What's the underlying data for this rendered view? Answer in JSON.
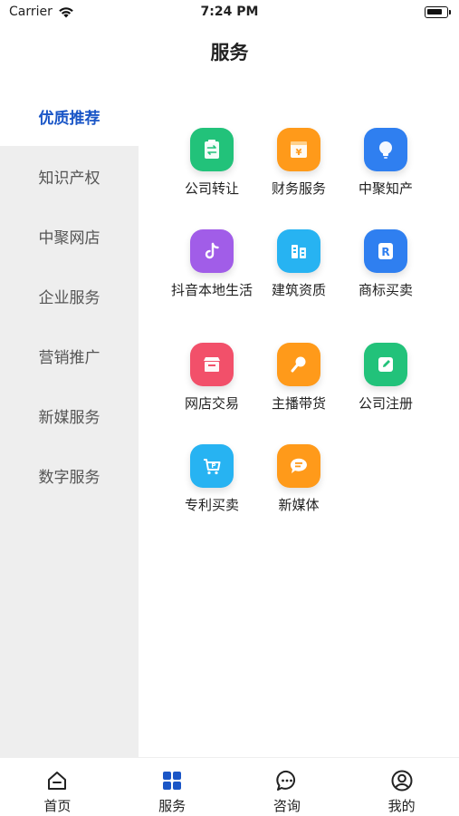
{
  "status_bar": {
    "carrier": "Carrier",
    "time": "7:24 PM"
  },
  "header": {
    "title": "服务"
  },
  "sidebar": {
    "items": [
      {
        "label": "优质推荐",
        "active": true
      },
      {
        "label": "知识产权",
        "active": false
      },
      {
        "label": "中聚网店",
        "active": false
      },
      {
        "label": "企业服务",
        "active": false
      },
      {
        "label": "营销推广",
        "active": false
      },
      {
        "label": "新媒服务",
        "active": false
      },
      {
        "label": "数字服务",
        "active": false
      }
    ]
  },
  "services": [
    {
      "label": "公司转让",
      "icon": "clipboard-transfer-icon",
      "color": "#22c27a"
    },
    {
      "label": "财务服务",
      "icon": "yuan-box-icon",
      "color": "#ff9a1a"
    },
    {
      "label": "中聚知产",
      "icon": "lightbulb-icon",
      "color": "#2f7ff0"
    },
    {
      "label": "抖音本地生活",
      "icon": "tiktok-icon",
      "color": "#a15de8"
    },
    {
      "label": "建筑资质",
      "icon": "building-icon",
      "color": "#27b3f2"
    },
    {
      "label": "商标买卖",
      "icon": "trademark-icon",
      "color": "#2f7ff0"
    },
    {
      "label": "网店交易",
      "icon": "shop-icon",
      "color": "#f2506a"
    },
    {
      "label": "主播带货",
      "icon": "microphone-icon",
      "color": "#ff9a1a"
    },
    {
      "label": "公司注册",
      "icon": "edit-doc-icon",
      "color": "#22c27a"
    },
    {
      "label": "专利买卖",
      "icon": "patent-cart-icon",
      "color": "#27b3f2"
    },
    {
      "label": "新媒体",
      "icon": "chat-bubble-icon",
      "color": "#ff9a1a"
    }
  ],
  "tabbar": {
    "items": [
      {
        "label": "首页",
        "icon": "home-icon"
      },
      {
        "label": "服务",
        "icon": "grid-icon",
        "active": true
      },
      {
        "label": "咨询",
        "icon": "chat-icon"
      },
      {
        "label": "我的",
        "icon": "user-icon"
      }
    ]
  }
}
